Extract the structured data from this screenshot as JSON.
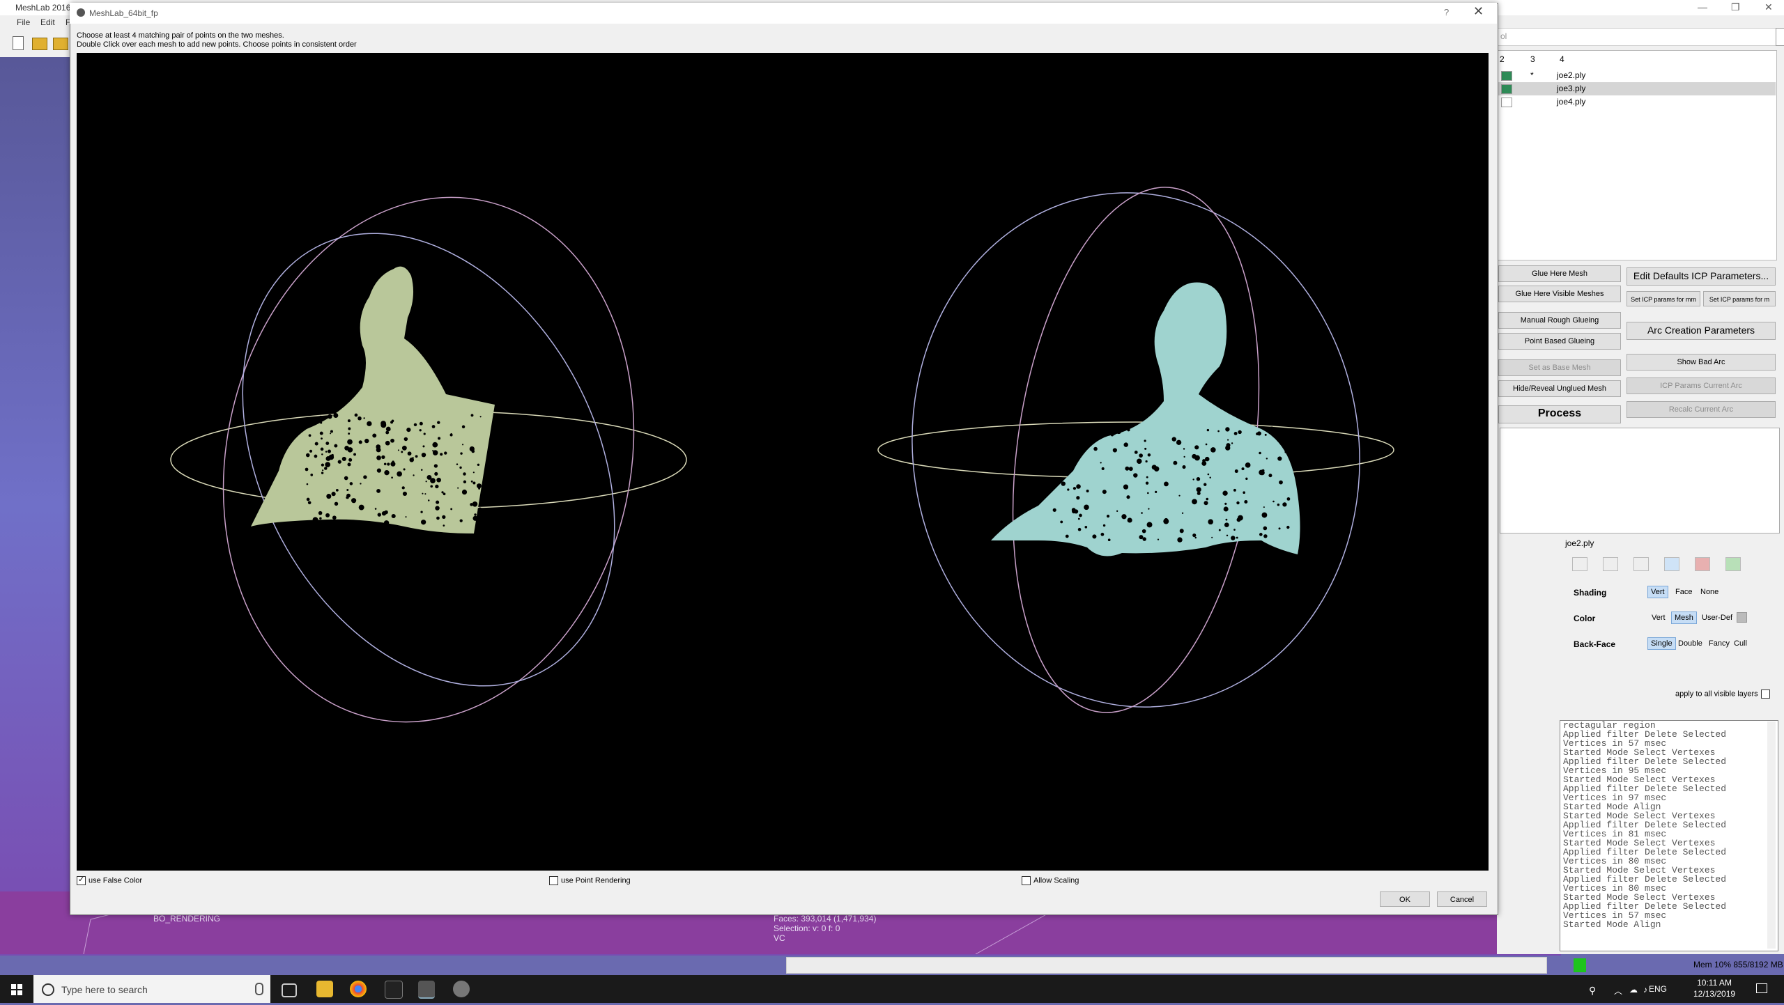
{
  "main_window": {
    "title": "MeshLab 2016",
    "menu": [
      "File",
      "Edit",
      "F"
    ],
    "controls": [
      "—",
      "❐",
      "✕"
    ]
  },
  "layers": {
    "header": [
      "2",
      "3",
      "4"
    ],
    "rows": [
      {
        "name": "joe2.ply",
        "mark": "*",
        "visible": true,
        "selected": false
      },
      {
        "name": "joe3.ply",
        "mark": "",
        "visible": true,
        "selected": true
      },
      {
        "name": "joe4.ply",
        "mark": "",
        "visible": false,
        "selected": false
      }
    ],
    "top_label": "ol"
  },
  "align_panel": {
    "glue_here_mesh": "Glue Here Mesh",
    "glue_visible": "Glue Here Visible Meshes",
    "manual_rough": "Manual Rough Glueing",
    "point_based": "Point Based Glueing",
    "set_base": "Set as Base Mesh",
    "hide_reveal": "Hide/Reveal Unglued Mesh",
    "process": "Process",
    "edit_icp": "Edit Defaults ICP Parameters...",
    "set_icp_mm": "Set ICP params for mm",
    "set_icp_m": "Set ICP params for m",
    "arc_params": "Arc Creation Parameters",
    "show_bad_arc": "Show Bad Arc",
    "icp_current": "ICP Params Current Arc",
    "recalc": "Recalc Current Arc"
  },
  "decorator": {
    "mesh_name": "joe2.ply",
    "shading_label": "Shading",
    "shading_opts": [
      "Vert",
      "Face",
      "None"
    ],
    "color_label": "Color",
    "color_opts": [
      "Vert",
      "Mesh",
      "User-Def"
    ],
    "backface_label": "Back-Face",
    "backface_opts": [
      "Single",
      "Double",
      "Fancy",
      "Cull"
    ],
    "apply_all": "apply to all visible layers"
  },
  "log_lines": [
    "rectagular region",
    "Applied filter Delete Selected",
    "Vertices in 57 msec",
    "Started Mode Select Vertexes",
    "Applied filter Delete Selected",
    "Vertices in 95 msec",
    "Started Mode Select Vertexes",
    "Applied filter Delete Selected",
    "Vertices in 97 msec",
    "Started Mode Align",
    "Started Mode Select Vertexes",
    "Applied filter Delete Selected",
    "Vertices in 81 msec",
    "Started Mode Select Vertexes",
    "Applied filter Delete Selected",
    "Vertices in 80 msec",
    "Started Mode Select Vertexes",
    "Applied filter Delete Selected",
    "Vertices in 80 msec",
    "Started Mode Select Vertexes",
    "Applied filter Delete Selected",
    "Vertices in 57 msec",
    "Started Mode Align"
  ],
  "status": {
    "faces": "Faces: 393,014    (1,471,934)",
    "selection": "Selection: v: 0 f: 0",
    "vc": "VC",
    "bo_rendering": "BO_RENDERING",
    "mem": "Mem 10% 855/8192 MB",
    "mem_fraction": 0.104
  },
  "dialog": {
    "title": "MeshLab_64bit_fp",
    "help": "?",
    "close": "✕",
    "instruction_1": "Choose at least 4 matching pair of points on the two meshes.",
    "instruction_2": "Double Click over each mesh to add new points. Choose points in consistent order",
    "use_false_color": "use False Color",
    "use_false_color_checked": true,
    "use_point_rendering": "use Point Rendering",
    "use_point_rendering_checked": false,
    "allow_scaling": "Allow Scaling",
    "allow_scaling_checked": false,
    "ok": "OK",
    "cancel": "Cancel",
    "left_mesh_color": "#b9c79a",
    "right_mesh_color": "#9fd3cf"
  },
  "taskbar": {
    "search_placeholder": "Type here to search",
    "lang": "ENG",
    "time": "10:11 AM",
    "date": "12/13/2019"
  }
}
